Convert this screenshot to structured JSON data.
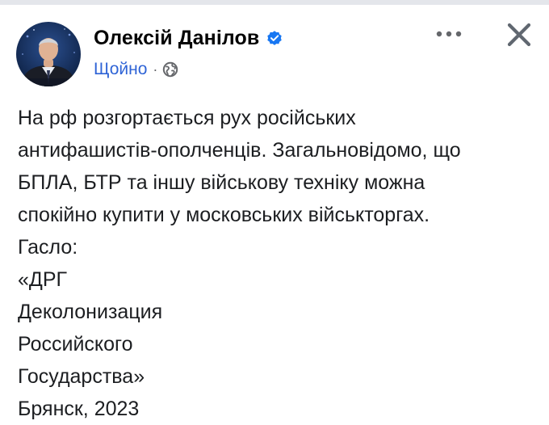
{
  "post": {
    "author": "Олексій Данілов",
    "verified_icon": "verified-badge-icon",
    "timestamp": "Щойно",
    "separator": "·",
    "audience_icon": "globe-icon",
    "more_icon": "more-options-icon",
    "close_icon": "close-icon",
    "body_lines": [
      "На рф розгортається рух російських",
      "антифашистів-ополченців. Загальновідомо, що",
      "БПЛА, БТР та іншу військову техніку можна",
      "спокійно купити у московських військторгах.",
      "Гасло:",
      "«ДРГ",
      "Деколонизация",
      "Российского",
      "Государства»",
      "Брянск, 2023"
    ]
  },
  "colors": {
    "verified_blue": "#1877f2",
    "timestamp_blue": "#2f64d6",
    "text": "#1c1e21",
    "icon_gray": "#65676b"
  }
}
